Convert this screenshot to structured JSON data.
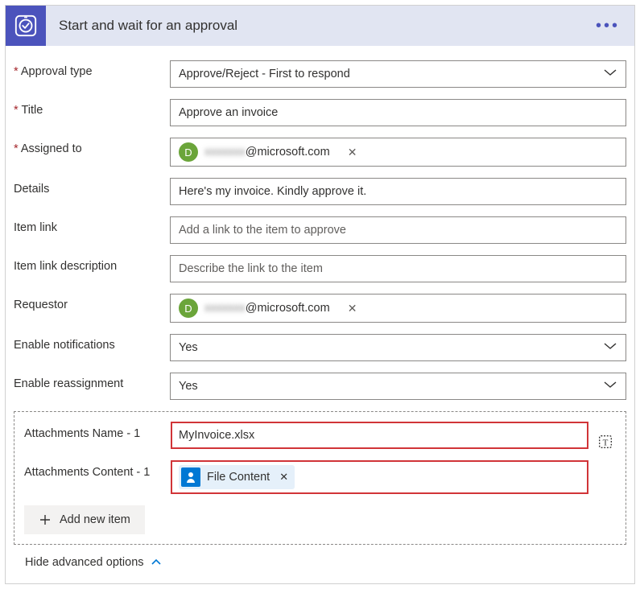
{
  "header": {
    "title": "Start and wait for an approval"
  },
  "fields": {
    "approval_type": {
      "label": "Approval type",
      "required": true,
      "value": "Approve/Reject - First to respond"
    },
    "title": {
      "label": "Title",
      "required": true,
      "value": "Approve an invoice"
    },
    "assigned_to": {
      "label": "Assigned to",
      "required": true,
      "chip_initial": "D",
      "chip_email_suffix": "@microsoft.com"
    },
    "details": {
      "label": "Details",
      "value": "Here's my invoice. Kindly approve it."
    },
    "item_link": {
      "label": "Item link",
      "placeholder": "Add a link to the item to approve"
    },
    "item_link_desc": {
      "label": "Item link description",
      "placeholder": "Describe the link to the item"
    },
    "requestor": {
      "label": "Requestor",
      "chip_initial": "D",
      "chip_email_suffix": "@microsoft.com"
    },
    "enable_notifications": {
      "label": "Enable notifications",
      "value": "Yes"
    },
    "enable_reassignment": {
      "label": "Enable reassignment",
      "value": "Yes"
    }
  },
  "attachments": {
    "name_label": "Attachments Name - 1",
    "name_value": "MyInvoice.xlsx",
    "content_label": "Attachments Content - 1",
    "content_token": "File Content",
    "add_item_label": "Add new item"
  },
  "footer": {
    "hide_advanced": "Hide advanced options"
  }
}
